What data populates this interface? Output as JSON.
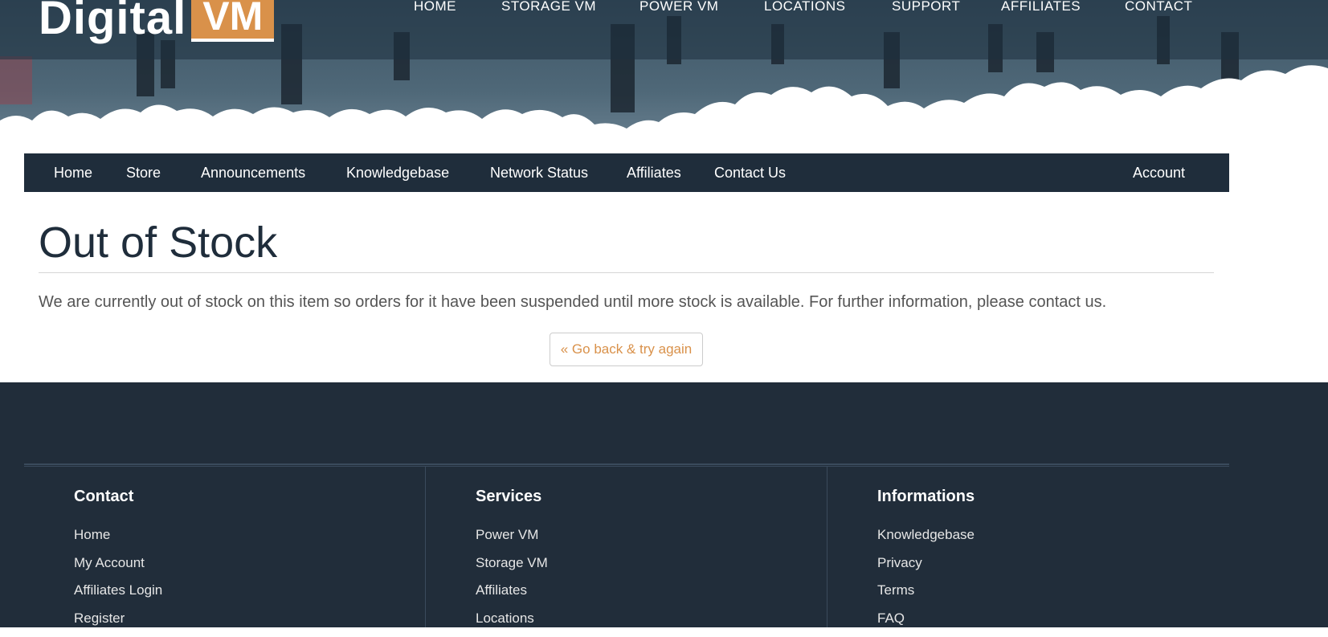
{
  "brand": {
    "logo_main": "Digital",
    "logo_accent": "VM",
    "accent_color": "#d9914a",
    "nav_color": "#1f2d3b",
    "footer_color": "#212d3a"
  },
  "top_nav": {
    "items": [
      {
        "label": "HOME"
      },
      {
        "label": "STORAGE VM"
      },
      {
        "label": "POWER VM"
      },
      {
        "label": "LOCATIONS"
      },
      {
        "label": "SUPPORT"
      },
      {
        "label": "AFFILIATES"
      },
      {
        "label": "CONTACT"
      }
    ]
  },
  "main_nav": {
    "items": [
      {
        "label": "Home"
      },
      {
        "label": "Store"
      },
      {
        "label": "Announcements"
      },
      {
        "label": "Knowledgebase"
      },
      {
        "label": "Network Status"
      },
      {
        "label": "Affiliates"
      },
      {
        "label": "Contact Us"
      }
    ],
    "account_label": "Account"
  },
  "content": {
    "title": "Out of Stock",
    "message": "We are currently out of stock on this item so orders for it have been suspended until more stock is available. For further information, please contact us.",
    "back_button": "« Go back & try again"
  },
  "footer": {
    "columns": [
      {
        "heading": "Contact",
        "links": [
          "Home",
          "My Account",
          "Affiliates Login",
          "Register"
        ]
      },
      {
        "heading": "Services",
        "links": [
          "Power VM",
          "Storage VM",
          "Affiliates",
          "Locations"
        ]
      },
      {
        "heading": "Informations",
        "links": [
          "Knowledgebase",
          "Privacy",
          "Terms",
          "FAQ"
        ]
      }
    ]
  }
}
